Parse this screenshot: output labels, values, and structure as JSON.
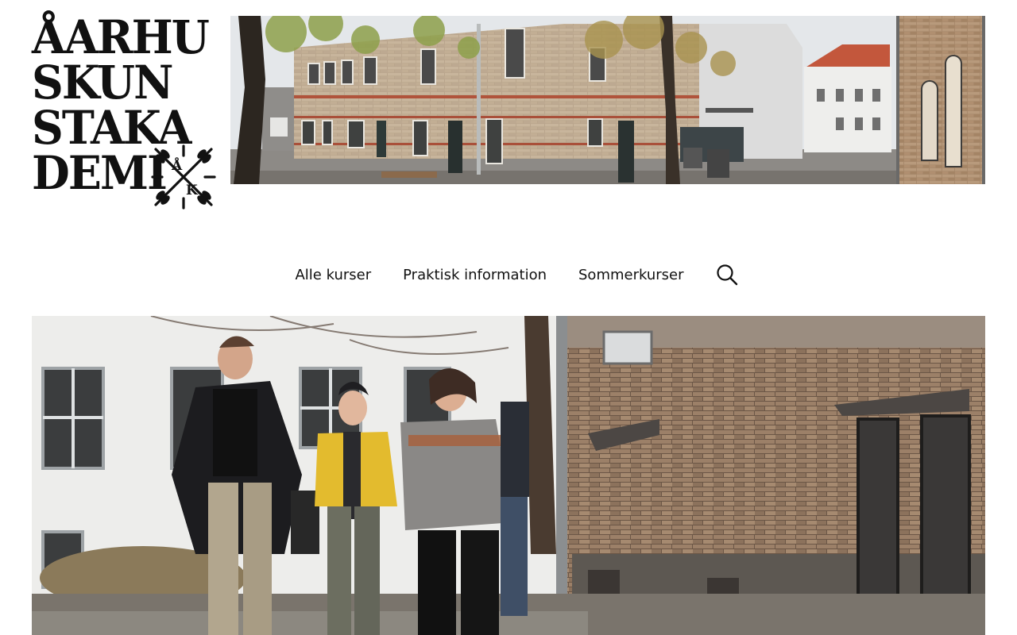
{
  "logo": {
    "lines": [
      "ÅARHU",
      "SKUN",
      "STAKA",
      "DEMI"
    ],
    "mark_letters": [
      "Å",
      "K"
    ]
  },
  "nav": {
    "items": [
      {
        "label": "Alle kurser"
      },
      {
        "label": "Praktisk information"
      },
      {
        "label": "Sommerkurser"
      }
    ],
    "search_icon": "search-icon"
  },
  "images": {
    "banner": "courtyard-brick-buildings-photo",
    "hero": "people-walking-by-brick-building-photo"
  },
  "colors": {
    "text": "#111111",
    "background": "#ffffff",
    "brick": "#a88f74",
    "brick_dark": "#5a4a3c",
    "sweater_yellow": "#e3bb2e"
  }
}
